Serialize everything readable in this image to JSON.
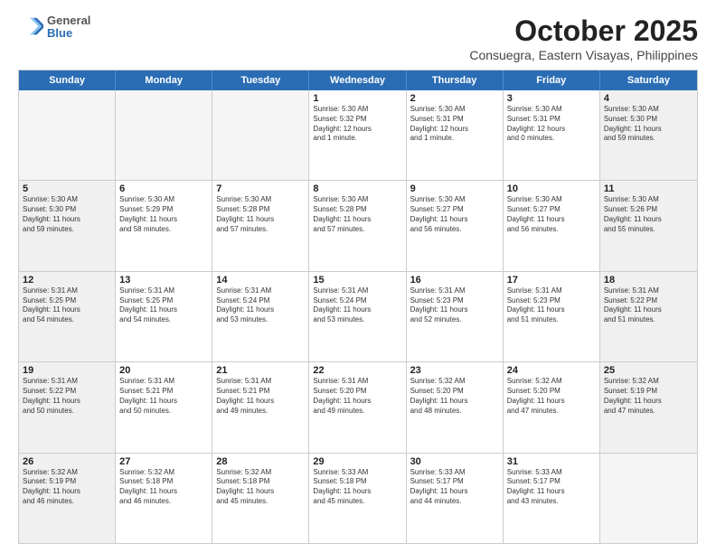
{
  "logo": {
    "line1": "General",
    "line2": "Blue"
  },
  "title": "October 2025",
  "subtitle": "Consuegra, Eastern Visayas, Philippines",
  "header_days": [
    "Sunday",
    "Monday",
    "Tuesday",
    "Wednesday",
    "Thursday",
    "Friday",
    "Saturday"
  ],
  "weeks": [
    [
      {
        "day": "",
        "text": "",
        "empty": true
      },
      {
        "day": "",
        "text": "",
        "empty": true
      },
      {
        "day": "",
        "text": "",
        "empty": true
      },
      {
        "day": "1",
        "text": "Sunrise: 5:30 AM\nSunset: 5:32 PM\nDaylight: 12 hours\nand 1 minute.",
        "empty": false
      },
      {
        "day": "2",
        "text": "Sunrise: 5:30 AM\nSunset: 5:31 PM\nDaylight: 12 hours\nand 1 minute.",
        "empty": false
      },
      {
        "day": "3",
        "text": "Sunrise: 5:30 AM\nSunset: 5:31 PM\nDaylight: 12 hours\nand 0 minutes.",
        "empty": false
      },
      {
        "day": "4",
        "text": "Sunrise: 5:30 AM\nSunset: 5:30 PM\nDaylight: 11 hours\nand 59 minutes.",
        "empty": false,
        "shaded": true
      }
    ],
    [
      {
        "day": "5",
        "text": "Sunrise: 5:30 AM\nSunset: 5:30 PM\nDaylight: 11 hours\nand 59 minutes.",
        "empty": false,
        "shaded": true
      },
      {
        "day": "6",
        "text": "Sunrise: 5:30 AM\nSunset: 5:29 PM\nDaylight: 11 hours\nand 58 minutes.",
        "empty": false
      },
      {
        "day": "7",
        "text": "Sunrise: 5:30 AM\nSunset: 5:28 PM\nDaylight: 11 hours\nand 57 minutes.",
        "empty": false
      },
      {
        "day": "8",
        "text": "Sunrise: 5:30 AM\nSunset: 5:28 PM\nDaylight: 11 hours\nand 57 minutes.",
        "empty": false
      },
      {
        "day": "9",
        "text": "Sunrise: 5:30 AM\nSunset: 5:27 PM\nDaylight: 11 hours\nand 56 minutes.",
        "empty": false
      },
      {
        "day": "10",
        "text": "Sunrise: 5:30 AM\nSunset: 5:27 PM\nDaylight: 11 hours\nand 56 minutes.",
        "empty": false
      },
      {
        "day": "11",
        "text": "Sunrise: 5:30 AM\nSunset: 5:26 PM\nDaylight: 11 hours\nand 55 minutes.",
        "empty": false,
        "shaded": true
      }
    ],
    [
      {
        "day": "12",
        "text": "Sunrise: 5:31 AM\nSunset: 5:25 PM\nDaylight: 11 hours\nand 54 minutes.",
        "empty": false,
        "shaded": true
      },
      {
        "day": "13",
        "text": "Sunrise: 5:31 AM\nSunset: 5:25 PM\nDaylight: 11 hours\nand 54 minutes.",
        "empty": false
      },
      {
        "day": "14",
        "text": "Sunrise: 5:31 AM\nSunset: 5:24 PM\nDaylight: 11 hours\nand 53 minutes.",
        "empty": false
      },
      {
        "day": "15",
        "text": "Sunrise: 5:31 AM\nSunset: 5:24 PM\nDaylight: 11 hours\nand 53 minutes.",
        "empty": false
      },
      {
        "day": "16",
        "text": "Sunrise: 5:31 AM\nSunset: 5:23 PM\nDaylight: 11 hours\nand 52 minutes.",
        "empty": false
      },
      {
        "day": "17",
        "text": "Sunrise: 5:31 AM\nSunset: 5:23 PM\nDaylight: 11 hours\nand 51 minutes.",
        "empty": false
      },
      {
        "day": "18",
        "text": "Sunrise: 5:31 AM\nSunset: 5:22 PM\nDaylight: 11 hours\nand 51 minutes.",
        "empty": false,
        "shaded": true
      }
    ],
    [
      {
        "day": "19",
        "text": "Sunrise: 5:31 AM\nSunset: 5:22 PM\nDaylight: 11 hours\nand 50 minutes.",
        "empty": false,
        "shaded": true
      },
      {
        "day": "20",
        "text": "Sunrise: 5:31 AM\nSunset: 5:21 PM\nDaylight: 11 hours\nand 50 minutes.",
        "empty": false
      },
      {
        "day": "21",
        "text": "Sunrise: 5:31 AM\nSunset: 5:21 PM\nDaylight: 11 hours\nand 49 minutes.",
        "empty": false
      },
      {
        "day": "22",
        "text": "Sunrise: 5:31 AM\nSunset: 5:20 PM\nDaylight: 11 hours\nand 49 minutes.",
        "empty": false
      },
      {
        "day": "23",
        "text": "Sunrise: 5:32 AM\nSunset: 5:20 PM\nDaylight: 11 hours\nand 48 minutes.",
        "empty": false
      },
      {
        "day": "24",
        "text": "Sunrise: 5:32 AM\nSunset: 5:20 PM\nDaylight: 11 hours\nand 47 minutes.",
        "empty": false
      },
      {
        "day": "25",
        "text": "Sunrise: 5:32 AM\nSunset: 5:19 PM\nDaylight: 11 hours\nand 47 minutes.",
        "empty": false,
        "shaded": true
      }
    ],
    [
      {
        "day": "26",
        "text": "Sunrise: 5:32 AM\nSunset: 5:19 PM\nDaylight: 11 hours\nand 46 minutes.",
        "empty": false,
        "shaded": true
      },
      {
        "day": "27",
        "text": "Sunrise: 5:32 AM\nSunset: 5:18 PM\nDaylight: 11 hours\nand 46 minutes.",
        "empty": false
      },
      {
        "day": "28",
        "text": "Sunrise: 5:32 AM\nSunset: 5:18 PM\nDaylight: 11 hours\nand 45 minutes.",
        "empty": false
      },
      {
        "day": "29",
        "text": "Sunrise: 5:33 AM\nSunset: 5:18 PM\nDaylight: 11 hours\nand 45 minutes.",
        "empty": false
      },
      {
        "day": "30",
        "text": "Sunrise: 5:33 AM\nSunset: 5:17 PM\nDaylight: 11 hours\nand 44 minutes.",
        "empty": false
      },
      {
        "day": "31",
        "text": "Sunrise: 5:33 AM\nSunset: 5:17 PM\nDaylight: 11 hours\nand 43 minutes.",
        "empty": false
      },
      {
        "day": "",
        "text": "",
        "empty": true
      }
    ]
  ]
}
